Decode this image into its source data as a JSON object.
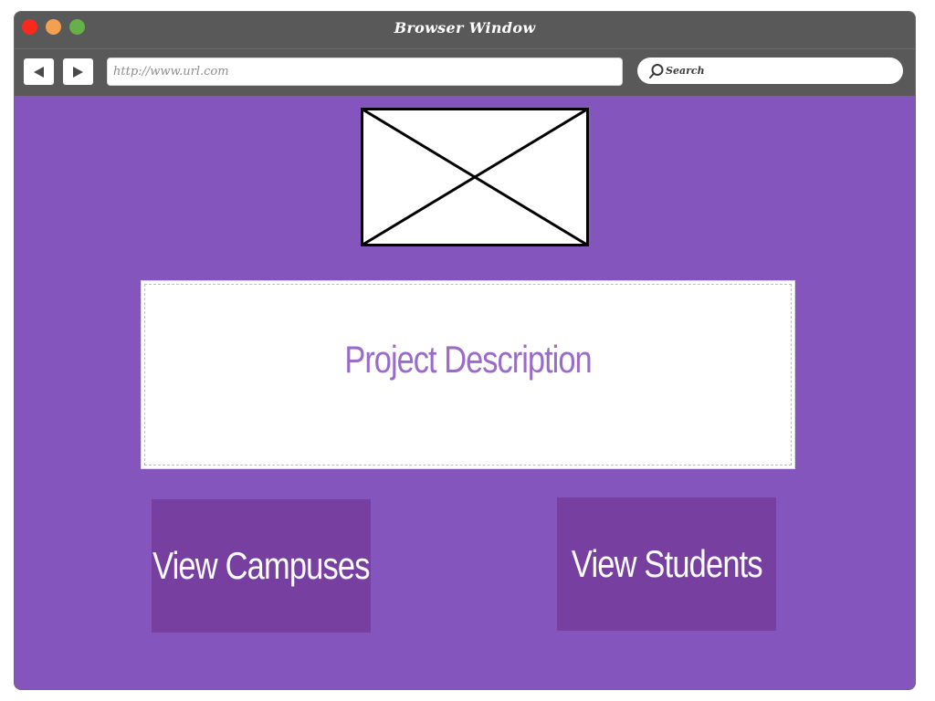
{
  "window": {
    "title": "Browser Window"
  },
  "toolbar": {
    "back_icon": "back-arrow-icon",
    "forward_icon": "forward-arrow-icon",
    "url": "http://www.url.com",
    "search_label": "Search"
  },
  "main": {
    "image_placeholder": "image-placeholder-icon",
    "description": "Project Description",
    "buttons": [
      {
        "label": "View Campuses"
      },
      {
        "label": "View Students"
      }
    ]
  },
  "colors": {
    "page_background": "#8456bd",
    "chrome": "#595959",
    "button_background": "#773fa0",
    "description_text": "#9a6cca",
    "close": "#f92a1d",
    "minimize": "#f4a052",
    "maximize": "#64b04a"
  }
}
